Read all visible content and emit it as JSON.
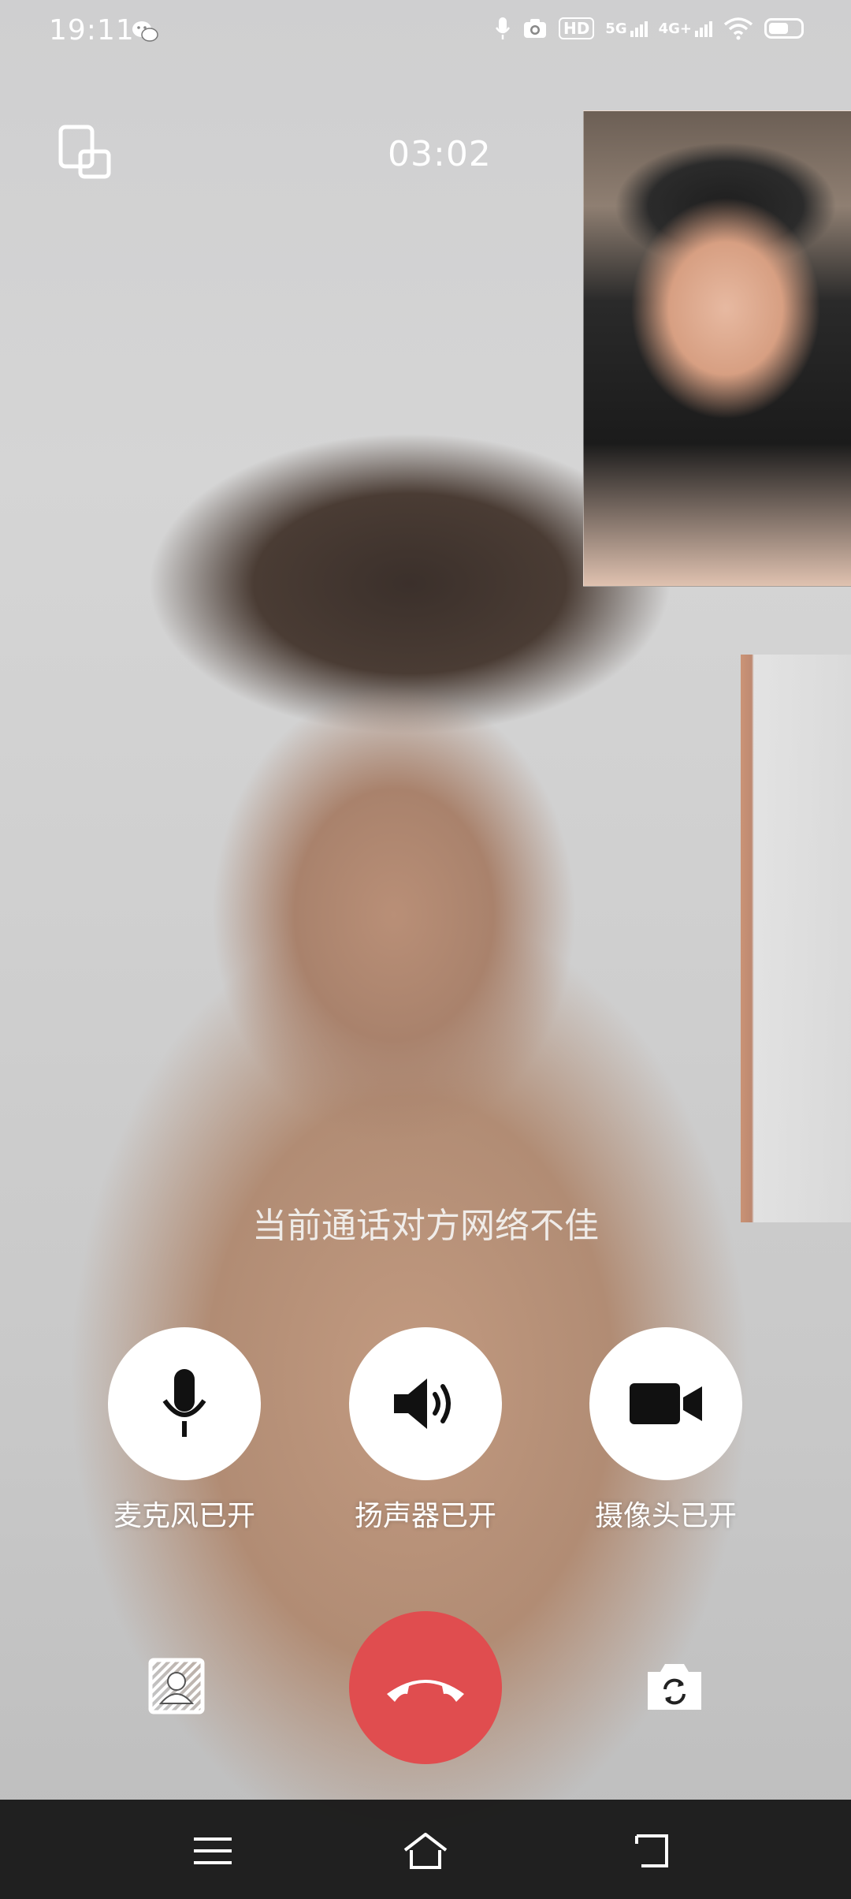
{
  "status_bar": {
    "time": "19:11",
    "icons": [
      "wechat-icon",
      "microphone-in-use-icon",
      "camera-in-use-icon",
      "hd-icon",
      "5g-signal-icon",
      "4g-signal-icon",
      "wifi-icon",
      "battery-icon"
    ],
    "hd_label": "HD",
    "net1": "5G",
    "net2": "4G+"
  },
  "call": {
    "timer": "03:02",
    "notice": "当前通话对方网络不佳"
  },
  "controls": {
    "mic_label": "麦克风已开",
    "speaker_label": "扬声器已开",
    "camera_label": "摄像头已开"
  },
  "icons": {
    "minimize": "minimize-window-icon",
    "mic": "microphone-icon",
    "speaker": "speaker-icon",
    "camera": "video-camera-icon",
    "hangup": "hang-up-icon",
    "effects": "background-effects-icon",
    "flip": "switch-camera-icon",
    "menu": "menu-icon",
    "home": "home-icon",
    "back": "back-icon"
  },
  "colors": {
    "hangup": "#e04d4f",
    "control_bg": "#ffffff",
    "navbar": "#121212"
  }
}
